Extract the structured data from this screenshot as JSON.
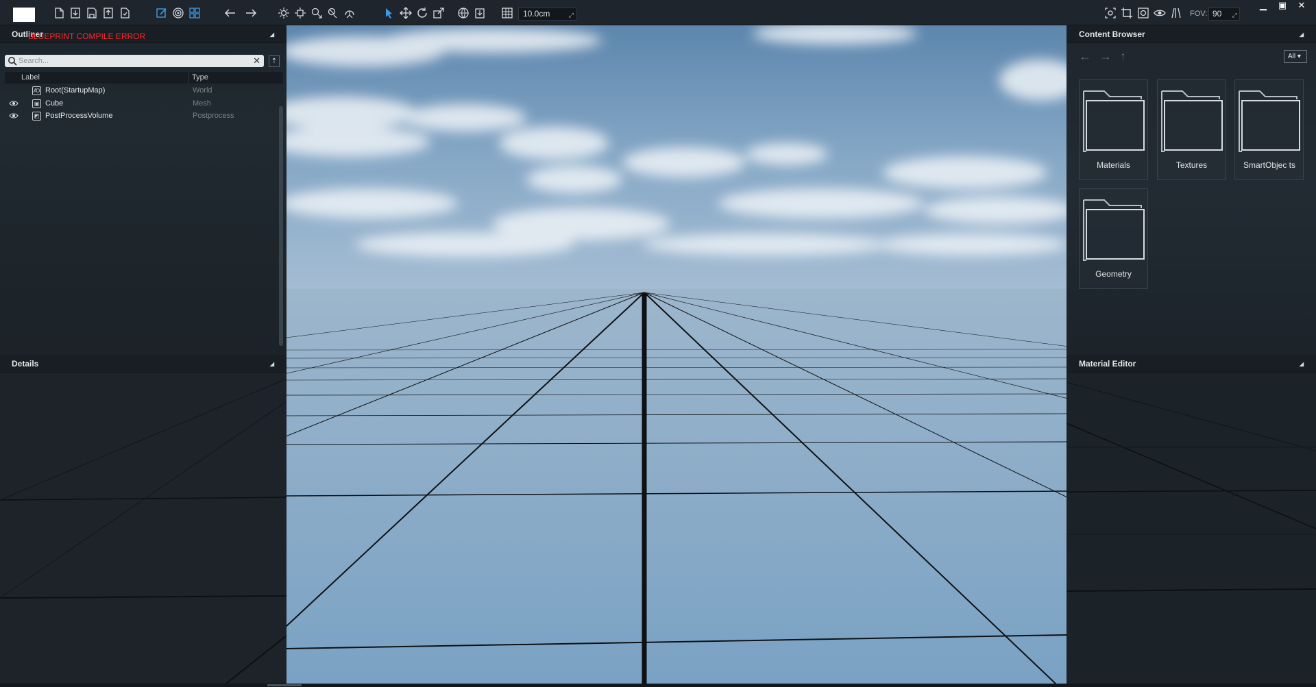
{
  "toolbar": {
    "snap_value": "10.0cm",
    "fov_label": "FOV:",
    "fov_value": "90"
  },
  "window_controls": {
    "minimize": "▁",
    "maximize": "▣",
    "close": "✕"
  },
  "outliner": {
    "title": "Outliner",
    "error_text": "BLUEPRINT COMPILE ERROR",
    "search_placeholder": "Search...",
    "columns": {
      "label": "Label",
      "type": "Type"
    },
    "rows": [
      {
        "name": "Root(StartupMap)",
        "type": "World",
        "icon": "map-icon"
      },
      {
        "name": "Cube",
        "type": "Mesh",
        "icon": "cube-icon"
      },
      {
        "name": "PostProcessVolume",
        "type": "Postprocess",
        "icon": "volume-icon"
      }
    ]
  },
  "details": {
    "title": "Details"
  },
  "content_browser": {
    "title": "Content Browser",
    "filter": "All",
    "folders": [
      {
        "label": "Materials"
      },
      {
        "label": "Textures"
      },
      {
        "label": "SmartObjec ts"
      },
      {
        "label": "Geometry"
      }
    ]
  },
  "material_editor": {
    "title": "Material Editor"
  },
  "colors": {
    "accent": "#3d9be9",
    "error": "#ff2a2a",
    "panel": "#1b2228"
  }
}
